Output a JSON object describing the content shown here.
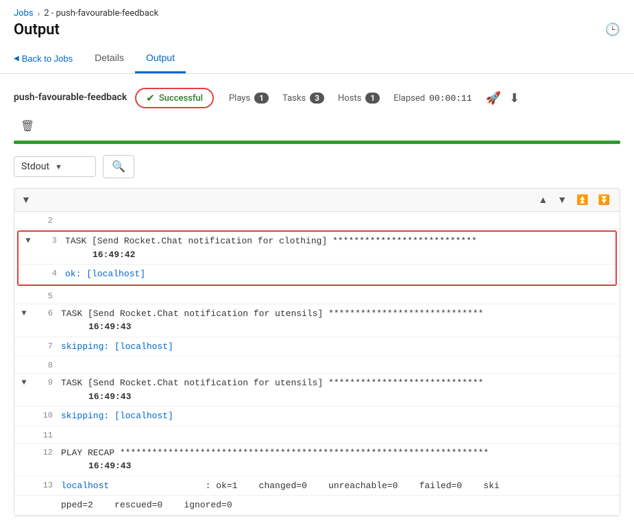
{
  "breadcrumb": {
    "jobs_label": "Jobs",
    "current_label": "2 - push-favourable-feedback"
  },
  "page": {
    "title": "Output",
    "history_icon": "↺"
  },
  "tabs": {
    "back_label": "Back to Jobs",
    "details_label": "Details",
    "output_label": "Output"
  },
  "job": {
    "name": "push-favourable-feedback",
    "status": "Successful",
    "plays_label": "Plays",
    "plays_count": "1",
    "tasks_label": "Tasks",
    "tasks_count": "3",
    "hosts_label": "Hosts",
    "hosts_count": "1",
    "elapsed_label": "Elapsed",
    "elapsed_value": "00:00:11"
  },
  "stdout": {
    "label": "Stdout",
    "search_placeholder": "Search"
  },
  "output_lines": [
    {
      "num": "2",
      "toggle": "",
      "content": "",
      "type": "blank"
    },
    {
      "num": "3",
      "toggle": "▼",
      "content": "TASK [Send Rocket.Chat notification for clothing] ***************************",
      "time": "16:49:42",
      "type": "task",
      "highlighted": true
    },
    {
      "num": "4",
      "toggle": "",
      "content": "ok: [localhost]",
      "type": "ok",
      "highlighted": true
    },
    {
      "num": "5",
      "toggle": "",
      "content": "",
      "type": "blank"
    },
    {
      "num": "6",
      "toggle": "▼",
      "content": "TASK [Send Rocket.Chat notification for utensils] ****************************",
      "time": "16:49:43",
      "type": "task"
    },
    {
      "num": "7",
      "toggle": "",
      "content": "skipping: [localhost]",
      "type": "skip"
    },
    {
      "num": "8",
      "toggle": "",
      "content": "",
      "type": "blank"
    },
    {
      "num": "9",
      "toggle": "▼",
      "content": "TASK [Send Rocket.Chat notification for utensils] ****************************",
      "time": "16:49:43",
      "type": "task"
    },
    {
      "num": "10",
      "toggle": "",
      "content": "skipping: [localhost]",
      "type": "skip"
    },
    {
      "num": "11",
      "toggle": "",
      "content": "",
      "type": "blank"
    },
    {
      "num": "12",
      "toggle": "",
      "content": "PLAY RECAP *********************************************************************",
      "time": "16:49:43",
      "type": "recap"
    },
    {
      "num": "13",
      "toggle": "",
      "content": "localhost                  : ok=1    changed=0    unreachable=0    failed=0    ski",
      "type": "stat"
    },
    {
      "num": "",
      "toggle": "",
      "content": "pped=2    rescued=0    ignored=0",
      "type": "stat-cont"
    }
  ]
}
